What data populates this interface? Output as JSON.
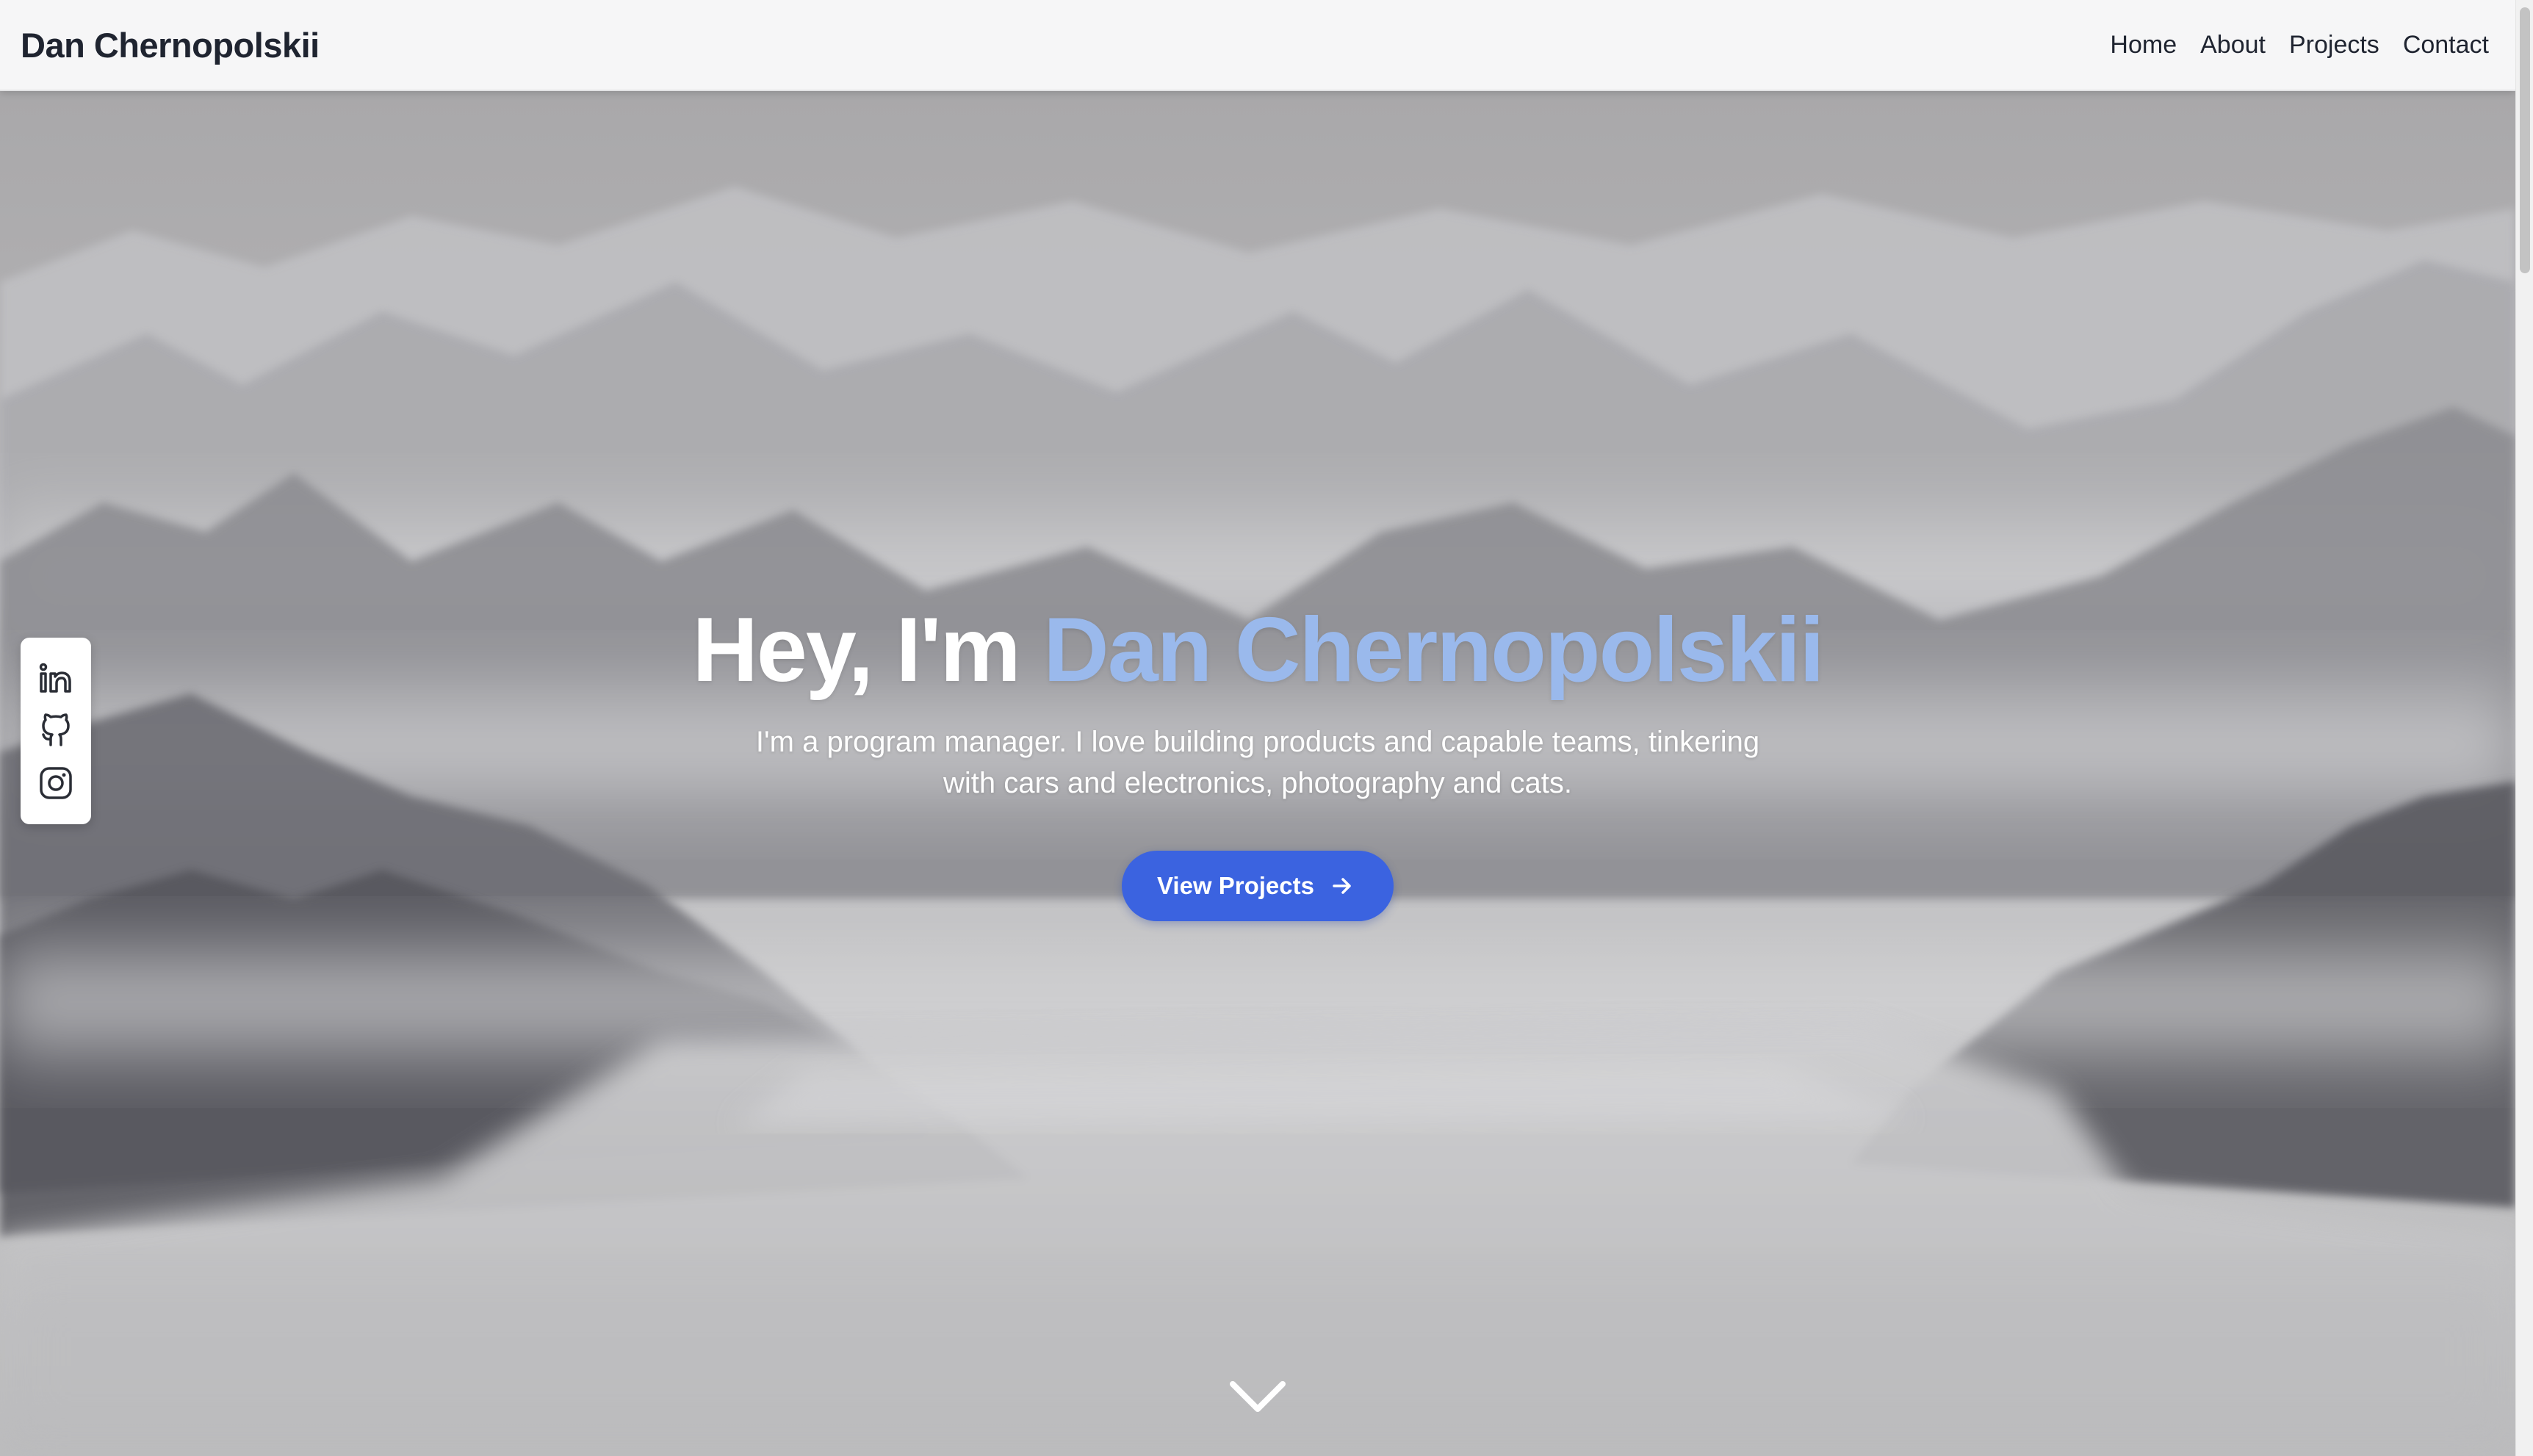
{
  "navbar": {
    "brand": "Dan Chernopolskii",
    "links": [
      "Home",
      "About",
      "Projects",
      "Contact"
    ]
  },
  "social": {
    "items": [
      {
        "name": "LinkedIn",
        "icon": "linkedin-icon"
      },
      {
        "name": "GitHub",
        "icon": "github-icon"
      },
      {
        "name": "Instagram",
        "icon": "instagram-icon"
      }
    ]
  },
  "hero": {
    "greeting": "Hey, I'm",
    "name": "Dan Chernopolskii",
    "subtitle": "I'm a program manager. I love building products and capable teams, tinkering with cars and electronics, photography and cats.",
    "cta_label": "View Projects",
    "cta_icon": "arrow-right-icon",
    "scroll_icon": "chevron-down-icon"
  },
  "colors": {
    "accent": "#9ab9ec",
    "button": "#3b63e0",
    "navbar_bg": "#f6f6f7"
  }
}
